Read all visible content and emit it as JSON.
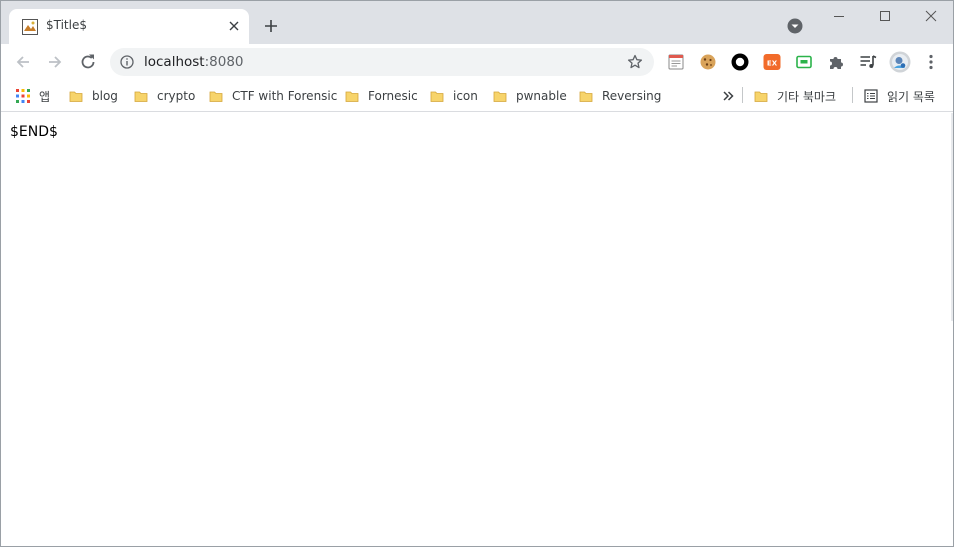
{
  "tab": {
    "title": "$Title$"
  },
  "address_bar": {
    "host": "localhost",
    "port": ":8080"
  },
  "bookmarks": {
    "apps_label": "앱",
    "items": [
      "blog",
      "crypto",
      "CTF with Forensic",
      "Fornesic",
      "icon",
      "pwnable",
      "Reversing"
    ],
    "other_label": "기타 북마크",
    "reading_list_label": "읽기 목록"
  },
  "extensions": [
    "notes-icon",
    "cookie-icon",
    "ring-icon",
    "ex-icon",
    "screen-icon",
    "puzzle-icon",
    "media-icon",
    "avatar"
  ],
  "ext_labels": {
    "ex": "EX"
  },
  "page": {
    "text": "$END$"
  },
  "colors": {
    "tabstrip": "#dee1e6",
    "folder": "#f7d46b",
    "omnibox": "#f1f3f4"
  }
}
